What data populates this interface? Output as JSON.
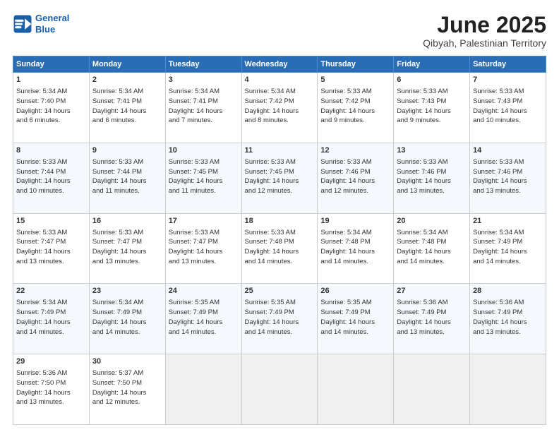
{
  "header": {
    "logo_line1": "General",
    "logo_line2": "Blue",
    "title": "June 2025",
    "subtitle": "Qibyah, Palestinian Territory"
  },
  "columns": [
    "Sunday",
    "Monday",
    "Tuesday",
    "Wednesday",
    "Thursday",
    "Friday",
    "Saturday"
  ],
  "weeks": [
    [
      {
        "day": "1",
        "lines": [
          "Sunrise: 5:34 AM",
          "Sunset: 7:40 PM",
          "Daylight: 14 hours",
          "and 6 minutes."
        ]
      },
      {
        "day": "2",
        "lines": [
          "Sunrise: 5:34 AM",
          "Sunset: 7:41 PM",
          "Daylight: 14 hours",
          "and 6 minutes."
        ]
      },
      {
        "day": "3",
        "lines": [
          "Sunrise: 5:34 AM",
          "Sunset: 7:41 PM",
          "Daylight: 14 hours",
          "and 7 minutes."
        ]
      },
      {
        "day": "4",
        "lines": [
          "Sunrise: 5:34 AM",
          "Sunset: 7:42 PM",
          "Daylight: 14 hours",
          "and 8 minutes."
        ]
      },
      {
        "day": "5",
        "lines": [
          "Sunrise: 5:33 AM",
          "Sunset: 7:42 PM",
          "Daylight: 14 hours",
          "and 9 minutes."
        ]
      },
      {
        "day": "6",
        "lines": [
          "Sunrise: 5:33 AM",
          "Sunset: 7:43 PM",
          "Daylight: 14 hours",
          "and 9 minutes."
        ]
      },
      {
        "day": "7",
        "lines": [
          "Sunrise: 5:33 AM",
          "Sunset: 7:43 PM",
          "Daylight: 14 hours",
          "and 10 minutes."
        ]
      }
    ],
    [
      {
        "day": "8",
        "lines": [
          "Sunrise: 5:33 AM",
          "Sunset: 7:44 PM",
          "Daylight: 14 hours",
          "and 10 minutes."
        ]
      },
      {
        "day": "9",
        "lines": [
          "Sunrise: 5:33 AM",
          "Sunset: 7:44 PM",
          "Daylight: 14 hours",
          "and 11 minutes."
        ]
      },
      {
        "day": "10",
        "lines": [
          "Sunrise: 5:33 AM",
          "Sunset: 7:45 PM",
          "Daylight: 14 hours",
          "and 11 minutes."
        ]
      },
      {
        "day": "11",
        "lines": [
          "Sunrise: 5:33 AM",
          "Sunset: 7:45 PM",
          "Daylight: 14 hours",
          "and 12 minutes."
        ]
      },
      {
        "day": "12",
        "lines": [
          "Sunrise: 5:33 AM",
          "Sunset: 7:46 PM",
          "Daylight: 14 hours",
          "and 12 minutes."
        ]
      },
      {
        "day": "13",
        "lines": [
          "Sunrise: 5:33 AM",
          "Sunset: 7:46 PM",
          "Daylight: 14 hours",
          "and 13 minutes."
        ]
      },
      {
        "day": "14",
        "lines": [
          "Sunrise: 5:33 AM",
          "Sunset: 7:46 PM",
          "Daylight: 14 hours",
          "and 13 minutes."
        ]
      }
    ],
    [
      {
        "day": "15",
        "lines": [
          "Sunrise: 5:33 AM",
          "Sunset: 7:47 PM",
          "Daylight: 14 hours",
          "and 13 minutes."
        ]
      },
      {
        "day": "16",
        "lines": [
          "Sunrise: 5:33 AM",
          "Sunset: 7:47 PM",
          "Daylight: 14 hours",
          "and 13 minutes."
        ]
      },
      {
        "day": "17",
        "lines": [
          "Sunrise: 5:33 AM",
          "Sunset: 7:47 PM",
          "Daylight: 14 hours",
          "and 13 minutes."
        ]
      },
      {
        "day": "18",
        "lines": [
          "Sunrise: 5:33 AM",
          "Sunset: 7:48 PM",
          "Daylight: 14 hours",
          "and 14 minutes."
        ]
      },
      {
        "day": "19",
        "lines": [
          "Sunrise: 5:34 AM",
          "Sunset: 7:48 PM",
          "Daylight: 14 hours",
          "and 14 minutes."
        ]
      },
      {
        "day": "20",
        "lines": [
          "Sunrise: 5:34 AM",
          "Sunset: 7:48 PM",
          "Daylight: 14 hours",
          "and 14 minutes."
        ]
      },
      {
        "day": "21",
        "lines": [
          "Sunrise: 5:34 AM",
          "Sunset: 7:49 PM",
          "Daylight: 14 hours",
          "and 14 minutes."
        ]
      }
    ],
    [
      {
        "day": "22",
        "lines": [
          "Sunrise: 5:34 AM",
          "Sunset: 7:49 PM",
          "Daylight: 14 hours",
          "and 14 minutes."
        ]
      },
      {
        "day": "23",
        "lines": [
          "Sunrise: 5:34 AM",
          "Sunset: 7:49 PM",
          "Daylight: 14 hours",
          "and 14 minutes."
        ]
      },
      {
        "day": "24",
        "lines": [
          "Sunrise: 5:35 AM",
          "Sunset: 7:49 PM",
          "Daylight: 14 hours",
          "and 14 minutes."
        ]
      },
      {
        "day": "25",
        "lines": [
          "Sunrise: 5:35 AM",
          "Sunset: 7:49 PM",
          "Daylight: 14 hours",
          "and 14 minutes."
        ]
      },
      {
        "day": "26",
        "lines": [
          "Sunrise: 5:35 AM",
          "Sunset: 7:49 PM",
          "Daylight: 14 hours",
          "and 14 minutes."
        ]
      },
      {
        "day": "27",
        "lines": [
          "Sunrise: 5:36 AM",
          "Sunset: 7:49 PM",
          "Daylight: 14 hours",
          "and 13 minutes."
        ]
      },
      {
        "day": "28",
        "lines": [
          "Sunrise: 5:36 AM",
          "Sunset: 7:49 PM",
          "Daylight: 14 hours",
          "and 13 minutes."
        ]
      }
    ],
    [
      {
        "day": "29",
        "lines": [
          "Sunrise: 5:36 AM",
          "Sunset: 7:50 PM",
          "Daylight: 14 hours",
          "and 13 minutes."
        ]
      },
      {
        "day": "30",
        "lines": [
          "Sunrise: 5:37 AM",
          "Sunset: 7:50 PM",
          "Daylight: 14 hours",
          "and 12 minutes."
        ]
      },
      null,
      null,
      null,
      null,
      null
    ]
  ]
}
